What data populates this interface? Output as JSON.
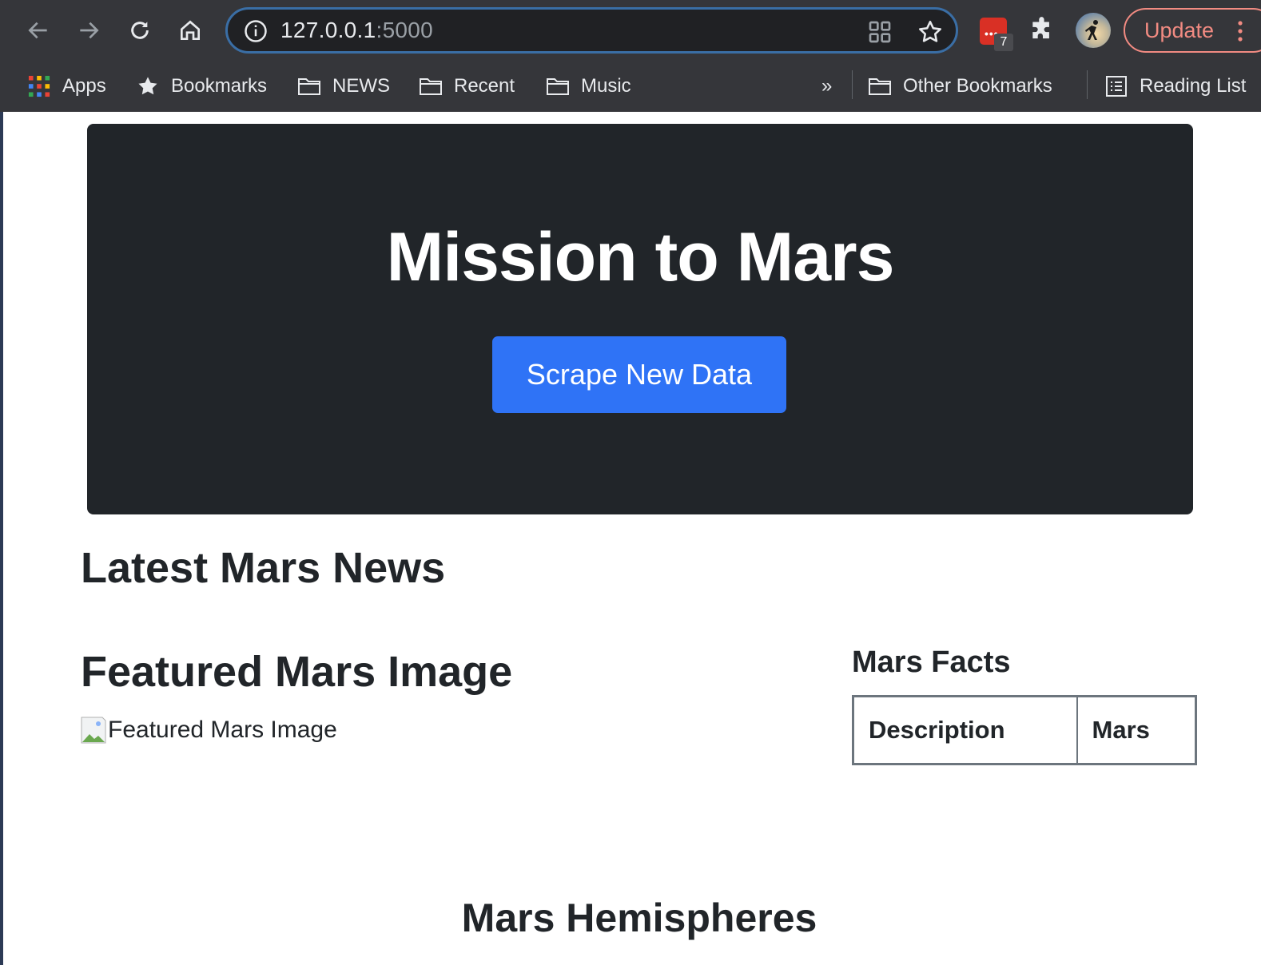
{
  "browser": {
    "url_host": "127.0.0.1",
    "url_port": ":5000",
    "extension_badge": "7",
    "update_label": "Update",
    "more_bookmarks": "»",
    "bookmarks": [
      "Apps",
      "Bookmarks",
      "NEWS",
      "Recent",
      "Music"
    ],
    "other_bookmarks": "Other Bookmarks",
    "reading_list": "Reading List",
    "colors": {
      "frame": "#35363a",
      "omnibox_bg": "#202124",
      "omnibox_border": "#3a6ea5",
      "update": "#f28b82"
    }
  },
  "page": {
    "title": "Mission to Mars",
    "scrape_button": "Scrape New Data",
    "news_heading": "Latest Mars News",
    "image_heading": "Featured Mars Image",
    "image_alt": "Featured Mars Image",
    "facts_heading": "Mars Facts",
    "facts_table": {
      "headers": [
        "Description",
        "Mars"
      ]
    },
    "hemispheres_heading": "Mars Hemispheres",
    "colors": {
      "jumbotron": "#212529",
      "button": "#2f73f6",
      "text": "#212529"
    }
  }
}
